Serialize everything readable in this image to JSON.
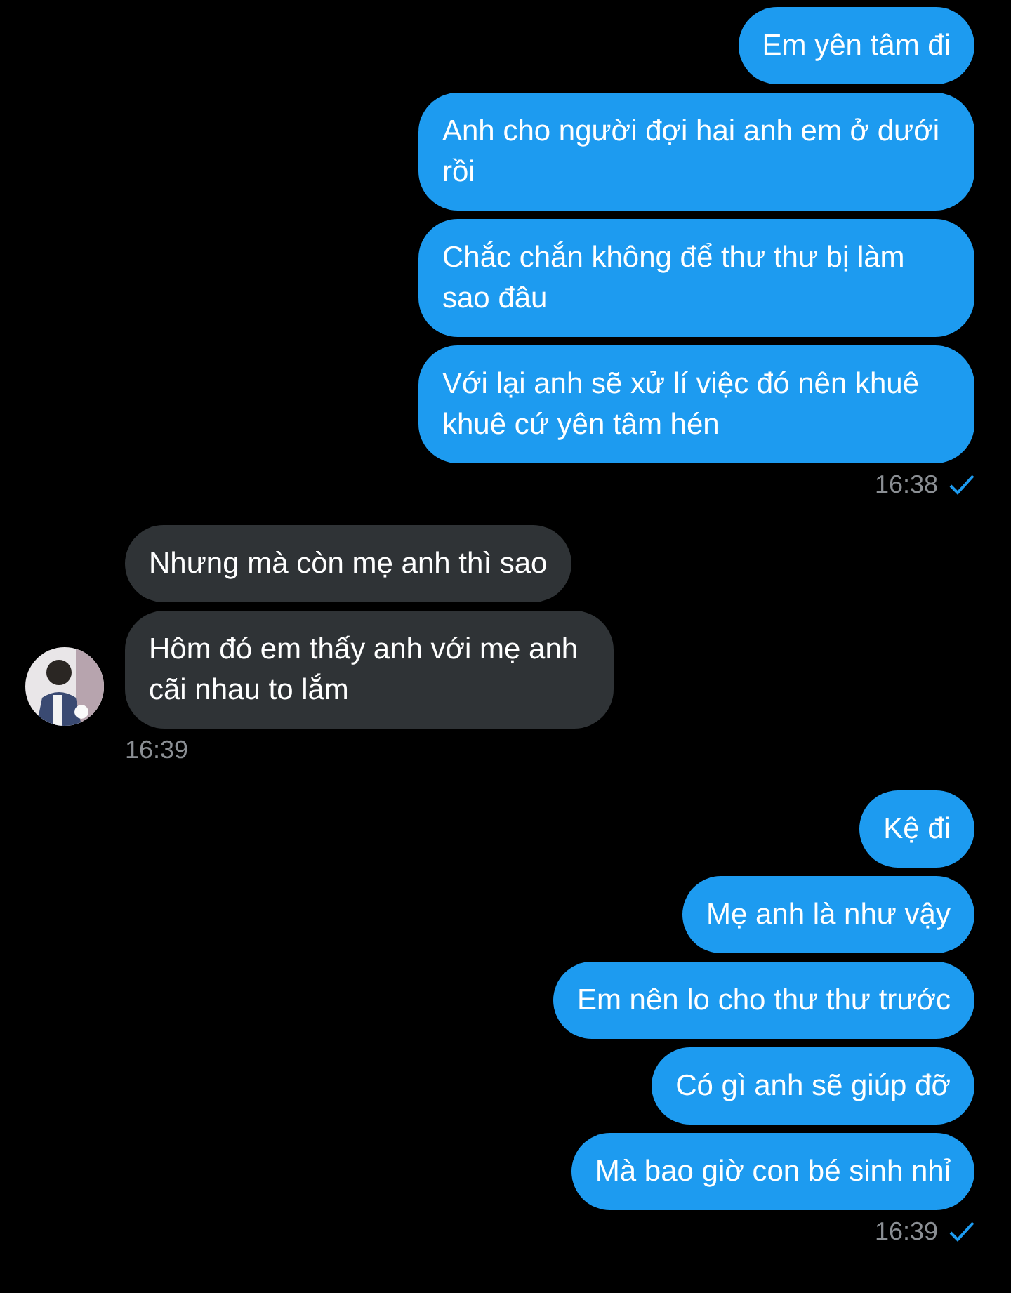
{
  "groups": [
    {
      "kind": "sent",
      "messages": [
        "Em yên tâm đi",
        "Anh cho người đợi hai anh em ở dưới rồi",
        "Chắc chắn không để thư thư bị làm sao đâu",
        "Với lại anh sẽ xử lí việc đó nên khuê khuê cứ yên tâm hén"
      ],
      "time": "16:38",
      "read": true
    },
    {
      "kind": "received",
      "messages": [
        "Nhưng mà còn mẹ anh thì sao",
        "Hôm đó em thấy anh với mẹ anh cãi nhau to lắm"
      ],
      "time": "16:39"
    },
    {
      "kind": "sent",
      "messages": [
        "Kệ đi",
        "Mẹ anh là như vậy",
        "Em nên lo cho thư thư trước",
        "Có gì anh sẽ giúp đỡ",
        "Mà bao giờ con bé sinh nhỉ"
      ],
      "time": "16:39",
      "read": true
    }
  ]
}
